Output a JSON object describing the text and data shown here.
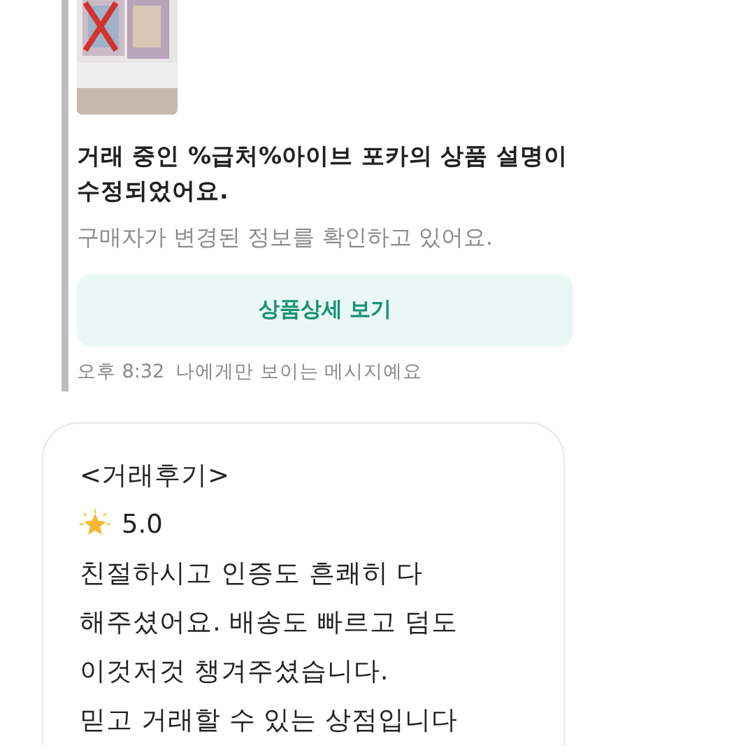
{
  "notice": {
    "title": "거래 중인 %급처%아이브  포카의 상품 설명이 수정되었어요.",
    "subtitle": "구매자가 변경된 정보를 확인하고 있어요.",
    "button": "상품상세 보기",
    "time": "오후 8:32",
    "visibility": "나에게만 보이는 메시지예요"
  },
  "review": {
    "heading": "<거래후기>",
    "rating": "5.0",
    "lines": [
      "친절하시고 인증도 흔쾌히 다",
      "해주셨어요. 배송도 빠르고 덤도",
      "이것저것 챙겨주셨습니다.",
      "믿고 거래할 수 있는 상점입니다"
    ]
  }
}
